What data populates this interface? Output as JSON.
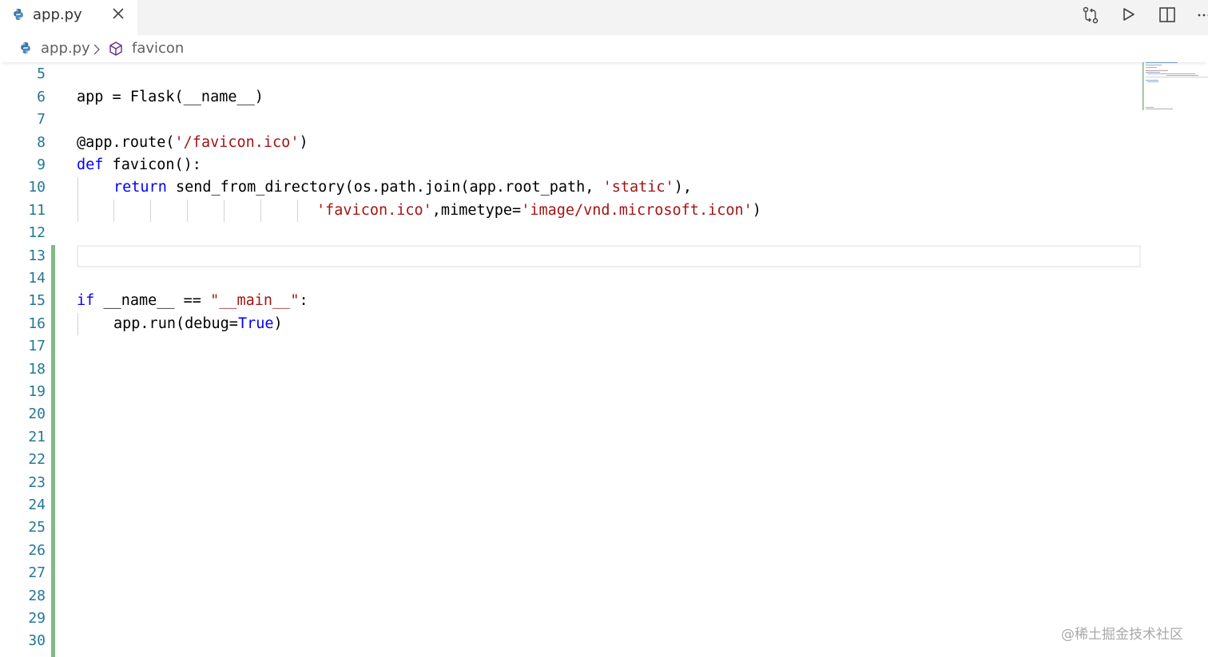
{
  "tab": {
    "label": "app.py",
    "icon": "python-icon",
    "close_icon": "close-icon"
  },
  "editor_actions": [
    {
      "name": "open-changes-button",
      "icon": "git-compare-icon"
    },
    {
      "name": "run-button",
      "icon": "play-icon"
    },
    {
      "name": "split-editor-button",
      "icon": "split-editor-icon"
    },
    {
      "name": "more-actions-button",
      "icon": "ellipsis-icon"
    }
  ],
  "breadcrumb": {
    "file": "app.py",
    "separator_icon": "chevron-right-icon",
    "symbol_icon": "symbol-method-icon",
    "symbol": "favicon"
  },
  "line_numbers": [
    "5",
    "6",
    "7",
    "8",
    "9",
    "10",
    "11",
    "12",
    "13",
    "14",
    "15",
    "16",
    "17",
    "18",
    "19",
    "20",
    "21",
    "22",
    "23",
    "24",
    "25",
    "26",
    "27",
    "28",
    "29",
    "30"
  ],
  "code": {
    "line6": {
      "a": "app = Flask(__name__)"
    },
    "line8": {
      "a": "@app.route(",
      "s": "'/favicon.ico'",
      "b": ")"
    },
    "line9": {
      "k": "def",
      "a": " favicon():"
    },
    "line10": {
      "k": "return",
      "a": " send_from_directory(os.path.join(app.root_path, ",
      "s": "'static'",
      "b": "),"
    },
    "line11": {
      "s1": "'favicon.ico'",
      "a": ",mimetype=",
      "s2": "'image/vnd.microsoft.icon'",
      "b": ")"
    },
    "line15": {
      "k": "if",
      "a": " __name__ == ",
      "s": "\"__main__\"",
      "b": ":"
    },
    "line16": {
      "a": "app.run(debug=",
      "k": "True",
      "b": ")"
    }
  },
  "watermark": "@稀土掘金技术社区",
  "colors": {
    "keyword": "#0000ff",
    "string": "#a31515",
    "line_number": "#237893",
    "gutter_modified": "#81b88b"
  }
}
